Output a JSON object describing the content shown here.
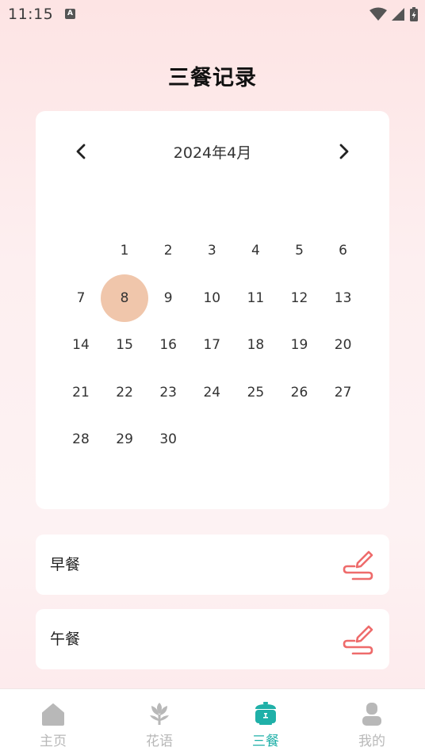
{
  "status_bar": {
    "time": "11:15",
    "notification_icon": "A"
  },
  "page": {
    "title": "三餐记录"
  },
  "calendar": {
    "month_label": "2024年4月",
    "prev_icon": "chevron-left-icon",
    "next_icon": "chevron-right-icon",
    "days": [
      "1",
      "2",
      "3",
      "4",
      "5",
      "6",
      "7",
      "8",
      "9",
      "10",
      "11",
      "12",
      "13",
      "14",
      "15",
      "16",
      "17",
      "18",
      "19",
      "20",
      "21",
      "22",
      "23",
      "24",
      "25",
      "26",
      "27",
      "28",
      "29",
      "30"
    ],
    "first_weekday_index": 1,
    "selected_day": "8",
    "selected_color": "#f0c6ab"
  },
  "meals": [
    {
      "label": "早餐",
      "icon": "pen-edit-icon"
    },
    {
      "label": "午餐",
      "icon": "pen-edit-icon"
    }
  ],
  "tab_bar": {
    "active_color": "#1fb0a8",
    "inactive_color": "#b8b8b8",
    "tabs": [
      {
        "label": "主页",
        "icon": "home-icon",
        "active": false
      },
      {
        "label": "花语",
        "icon": "flower-icon",
        "active": false
      },
      {
        "label": "三餐",
        "icon": "rice-cooker-icon",
        "active": true
      },
      {
        "label": "我的",
        "icon": "user-icon",
        "active": false
      }
    ]
  }
}
